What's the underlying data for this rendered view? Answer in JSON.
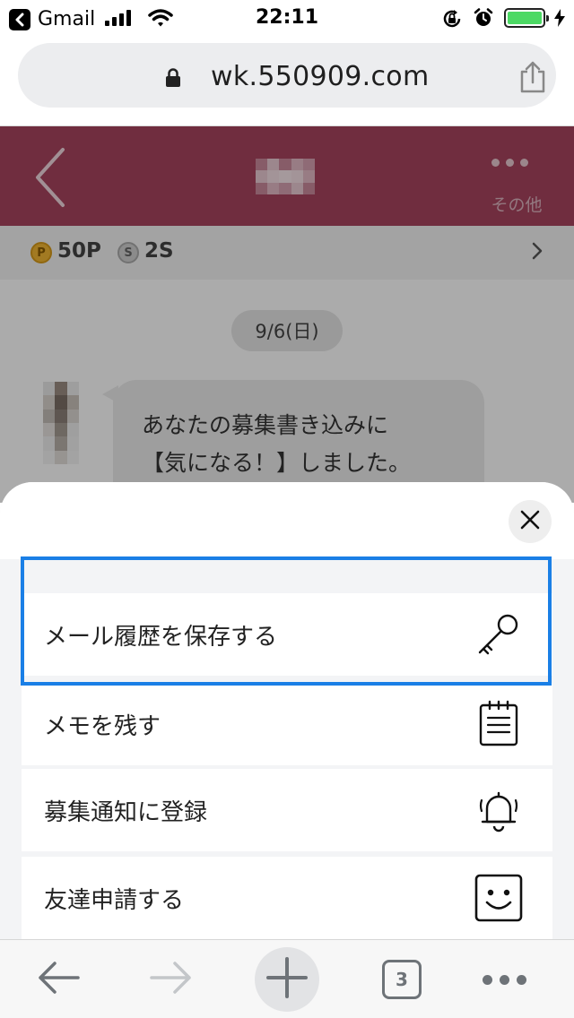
{
  "status_bar": {
    "back_app": "Gmail",
    "time": "22:11",
    "battery_color": "#4cd964"
  },
  "browser": {
    "url": "wk.550909.com",
    "lock_icon": "lock-icon",
    "share_icon": "share-icon"
  },
  "page": {
    "header": {
      "back_icon": "chevron-left-icon",
      "more_icon": "more-dots-icon",
      "more_label": "その他",
      "accent_color": "#a8445e"
    },
    "points": {
      "p_badge": "P",
      "p_value": "50P",
      "s_badge": "S",
      "s_value": "2S"
    },
    "chat": {
      "date": "9/6(日)",
      "message_line1": "あなたの募集書き込みに",
      "message_line2": "【気になる！】しました。"
    }
  },
  "sheet": {
    "close_icon": "close-icon",
    "items": [
      {
        "label": "メール履歴を保存する",
        "icon": "key-icon"
      },
      {
        "label": "メモを残す",
        "icon": "memo-pad-icon"
      },
      {
        "label": "募集通知に登録",
        "icon": "bell-icon"
      },
      {
        "label": "友達申請する",
        "icon": "smiley-icon"
      }
    ],
    "focus_color": "#1a7fe6"
  },
  "toolbar": {
    "tab_count": "3"
  }
}
